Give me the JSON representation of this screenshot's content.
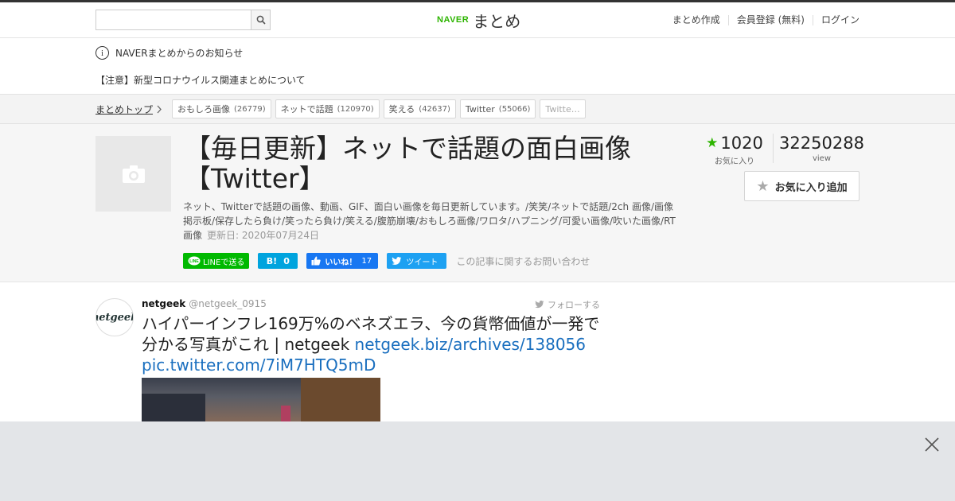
{
  "header": {
    "search": {
      "placeholder": "",
      "value": ""
    },
    "logo": {
      "naver": "NAVER",
      "matome": "まとめ"
    },
    "nav": [
      "まとめ作成",
      "会員登録 (無料)",
      "ログイン"
    ]
  },
  "notice": {
    "heading": "NAVERまとめからのお知らせ",
    "item": "【注意】新型コロナウイルス関連まとめについて"
  },
  "breadcrumb": {
    "top": "まとめトップ",
    "tags": [
      {
        "label": "おもしろ画像",
        "count": "(26779)"
      },
      {
        "label": "ネットで話題",
        "count": "(120970)"
      },
      {
        "label": "笑える",
        "count": "(42637)"
      },
      {
        "label": "Twitter",
        "count": "(55066)"
      },
      {
        "label": "Twitte…",
        "count": ""
      }
    ]
  },
  "article": {
    "title": "【毎日更新】ネットで話題の面白画像【Twitter】",
    "description": "ネット、Twitterで話題の画像、動画、GIF、面白い画像を毎日更新しています。/笑笑/ネットで話題/2ch 画像/画像掲示板/保存したら負け/笑ったら負け/笑える/腹筋崩壊/おもしろ画像/ワロタ/ハプニング/可愛い画像/吹いた画像/RT画像",
    "updated": "更新日: 2020年07月24日",
    "favorites": {
      "count": "1020",
      "label": "お気に入り"
    },
    "views": {
      "count": "32250288",
      "label": "view"
    },
    "fav_button": "お気に入り追加",
    "share": {
      "line": "LINEで送る",
      "hatena_icon": "B!",
      "hatena_count": "0",
      "fb_label": "いいね！",
      "fb_count": "17",
      "tweet": "ツイート",
      "inquiry": "この記事に関するお問い合わせ"
    }
  },
  "tweet": {
    "avatar_text": "netgeek",
    "name": "netgeek",
    "handle": "@netgeek_0915",
    "follow": "フォローする",
    "text": "ハイパーインフレ169万%のベネズエラ、今の貨幣価値が一発で分かる写真がこれ | netgeek ",
    "link1": "netgeek.biz/archives/138056",
    "link2": "pic.twitter.com/7iM7HTQ5mD"
  },
  "colors": {
    "accent": "#2db400",
    "link": "#1a6fbf",
    "line": "#00b900",
    "hatena": "#00a4de",
    "facebook": "#1877f2",
    "twitter": "#1da1f2"
  }
}
